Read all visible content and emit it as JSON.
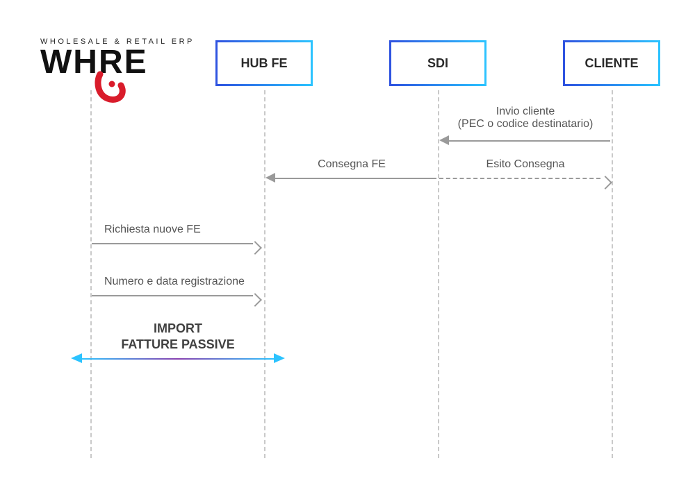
{
  "logo": {
    "tagline": "WHOLESALE & RETAIL ERP",
    "word_part1": "WH",
    "word_part2": "RE"
  },
  "actors": {
    "hub": "HUB FE",
    "sdi": "SDI",
    "cliente": "CLIENTE"
  },
  "messages": {
    "invio_cliente_l1": "Invio cliente",
    "invio_cliente_l2": "(PEC o codice destinatario)",
    "consegna_fe": "Consegna FE",
    "esito_consegna": "Esito Consegna",
    "richiesta_nuove": "Richiesta nuove FE",
    "numero_data": "Numero e data registrazione",
    "import_l1": "IMPORT",
    "import_l2": "FATTURE PASSIVE"
  },
  "lifeline_x": {
    "where": 130,
    "hub": 380,
    "sdi": 630,
    "cliente": 880
  }
}
